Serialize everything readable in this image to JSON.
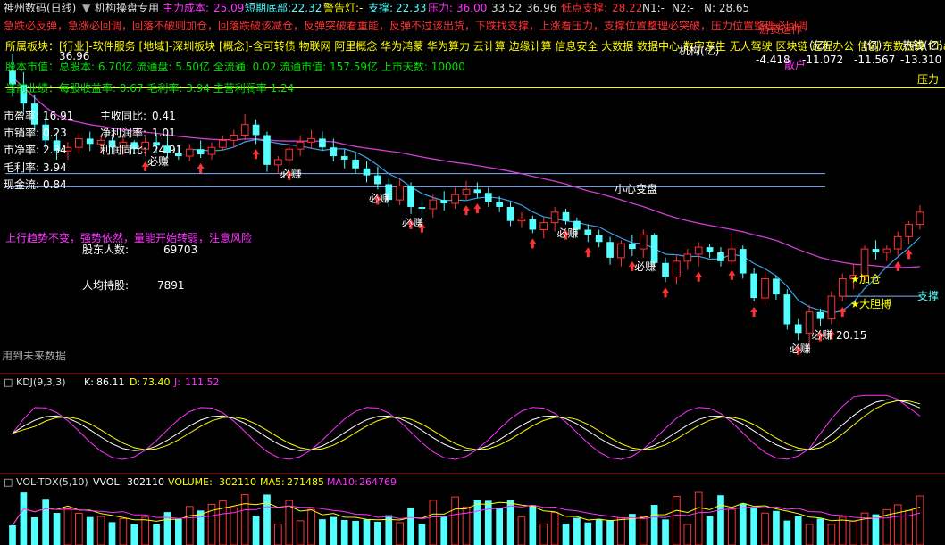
{
  "header": {
    "stock_name": "神州数码(日线)",
    "indicator_name": "机构操盘专用",
    "main_cost_label": "主力成本:",
    "main_cost": "25.09",
    "short_bottom_label": "短期底部:",
    "short_bottom": "22.32",
    "alarm_label": "警告灯:-",
    "support_label": "支撑:",
    "support": "22.33",
    "pressure_label": "压力:",
    "pressure": "36.00",
    "mid1": "33.52",
    "mid2": "36.96",
    "low_support_label": "低点支撑:",
    "low_support": "28.22",
    "n_values": "N1:-",
    "n2_value": "N2:-",
    "n_value": "N: 28.65"
  },
  "ticker_text": "急跌必反弹，急涨必回调，回落不破则加仓，回落跌破该减仓，反弹突破看重能，反弹不过该出货，下跌找支撑，上涨看压力，支撑位置整理必突破，压力位置整理必回调",
  "info": {
    "sector": "所属板块：[行业]-软件服务 [地域]-深圳板块 [概念]-含可转债 物联网 阿里概念 华为鸿蒙 华为算力 云计算 边缘计算 信息安全 大数据 数据中心 数字孪生 无人驾驶 区块链 远程办公 信创 东数西算 ChatGPT",
    "market_cap": "股本市值：总股本: 6.70亿 流通盘: 5.50亿 全流通: 0.02 流通市值: 157.59亿 上市天数: 10000",
    "performance": "当前业绩：每股收益率: 0.67 毛利率: 3.94 主营利润率 1.24",
    "pe_label": "市盈率:",
    "pe": "16.91",
    "ps_label": "市销率:",
    "ps": "0.23",
    "pb_label": "市净率:",
    "pb": "2.34",
    "gross_label": "毛利率:",
    "gross": "3.94",
    "cash_label": "现金流:",
    "cash": "0.84",
    "rev_yoy_label": "主收同比:",
    "rev_yoy": "0.41",
    "net_margin_label": "净利润率:",
    "net_margin": "1.01",
    "profit_yoy_label": "利润同比:",
    "profit_yoy": "24.91",
    "trend_text": "上行趋势不变，强势依然，量能开始转弱，注意风险",
    "holders_label": "股东人数:",
    "holders": "69703",
    "per_holding_label": "人均持股:",
    "per_holding": "7891",
    "future_data": "用到未来数据"
  },
  "price_chart": {
    "high_label": "36.96",
    "low_label": "20.15",
    "support_tag": "支撑",
    "pressure_tag": "压力",
    "caution_label": "小心变盘",
    "buy_label": "必赚",
    "add_label": "加仓",
    "bold_label": "大胆搏",
    "right_labels": {
      "top": "游资运作",
      "institution": "机构(亿)",
      "retail": "散户",
      "m1": "(亿)",
      "m2": "(亿)",
      "hot": "热钱(亿)",
      "v1": "-4.418",
      "v2": "-11.072",
      "v3": "-11.567",
      "v4": "-13.310"
    }
  },
  "kdj": {
    "title": "KDJ(9,3,3)",
    "k_label": "K:",
    "k": "86.11",
    "d_label": "D:",
    "d": "73.40",
    "j_label": "J:",
    "j": "111.52"
  },
  "vol": {
    "title": "VOL-TDX(5,10)",
    "vvol_label": "VVOL:",
    "vvol": "302110",
    "volume_label": "VOLUME:",
    "volume": "302110",
    "ma5_label": "MA5:",
    "ma5": "271485",
    "ma10_label": "MA10:",
    "ma10": "264769"
  },
  "colors": {
    "up": "#ff3232",
    "down": "#54ffff",
    "ma_purple": "#d33cd3",
    "ma_blue": "#3aa0e8",
    "yellow": "#ffff00",
    "magenta": "#ff32ff",
    "green": "#00e000"
  },
  "candles": [
    [
      36.0,
      36.96,
      34.5,
      35.2
    ],
    [
      35.2,
      35.9,
      33.6,
      34.1
    ],
    [
      34.1,
      34.6,
      32.5,
      32.9
    ],
    [
      32.9,
      33.4,
      31.5,
      32.0
    ],
    [
      32.0,
      32.4,
      30.9,
      31.4
    ],
    [
      31.4,
      31.9,
      30.9,
      31.6
    ],
    [
      31.6,
      32.4,
      31.2,
      32.1
    ],
    [
      32.1,
      32.5,
      31.4,
      31.8
    ],
    [
      31.8,
      32.3,
      31.3,
      32.0
    ],
    [
      32.0,
      32.2,
      31.3,
      31.6
    ],
    [
      31.6,
      32.3,
      31.2,
      31.9
    ],
    [
      31.9,
      32.0,
      31.2,
      31.5
    ],
    [
      31.5,
      32.2,
      31.1,
      31.9
    ],
    [
      31.9,
      32.4,
      31.3,
      31.7
    ],
    [
      31.7,
      32.3,
      31.0,
      31.3
    ],
    [
      31.3,
      31.7,
      30.9,
      31.1
    ],
    [
      31.1,
      31.8,
      30.8,
      31.5
    ],
    [
      31.5,
      32.0,
      31.0,
      31.2
    ],
    [
      31.2,
      31.9,
      30.9,
      31.6
    ],
    [
      31.6,
      32.3,
      31.4,
      32.0
    ],
    [
      32.0,
      32.6,
      31.6,
      32.3
    ],
    [
      32.3,
      33.5,
      32.0,
      32.9
    ],
    [
      32.9,
      33.2,
      31.8,
      32.3
    ],
    [
      32.3,
      32.5,
      30.2,
      30.6
    ],
    [
      30.6,
      31.1,
      30.1,
      30.9
    ],
    [
      30.9,
      31.8,
      30.6,
      31.5
    ],
    [
      31.5,
      32.3,
      31.1,
      31.9
    ],
    [
      31.9,
      32.6,
      31.5,
      32.1
    ],
    [
      32.1,
      32.5,
      31.4,
      31.6
    ],
    [
      31.6,
      32.1,
      30.8,
      31.1
    ],
    [
      31.1,
      31.5,
      30.4,
      30.9
    ],
    [
      30.9,
      31.3,
      30.1,
      30.4
    ],
    [
      30.4,
      30.8,
      29.6,
      30.0
    ],
    [
      30.0,
      30.5,
      29.2,
      29.5
    ],
    [
      29.5,
      29.9,
      28.2,
      28.6
    ],
    [
      28.6,
      29.8,
      28.3,
      29.4
    ],
    [
      29.4,
      29.6,
      27.8,
      28.2
    ],
    [
      28.2,
      28.7,
      27.6,
      28.1
    ],
    [
      28.1,
      28.9,
      27.6,
      28.6
    ],
    [
      28.6,
      29.1,
      28.0,
      28.4
    ],
    [
      28.4,
      29.3,
      28.1,
      28.9
    ],
    [
      28.9,
      29.7,
      28.6,
      29.2
    ],
    [
      29.2,
      29.6,
      28.7,
      29.0
    ],
    [
      29.0,
      29.3,
      28.2,
      28.5
    ],
    [
      28.5,
      28.8,
      27.9,
      28.2
    ],
    [
      28.2,
      28.5,
      27.1,
      27.4
    ],
    [
      27.4,
      27.9,
      27.0,
      27.5
    ],
    [
      27.5,
      27.7,
      26.7,
      26.9
    ],
    [
      26.9,
      27.6,
      26.4,
      27.3
    ],
    [
      27.3,
      28.2,
      26.8,
      27.9
    ],
    [
      27.9,
      28.1,
      27.2,
      27.4
    ],
    [
      27.4,
      27.6,
      26.6,
      26.9
    ],
    [
      26.9,
      27.2,
      26.2,
      26.6
    ],
    [
      26.6,
      26.9,
      25.9,
      26.2
    ],
    [
      26.2,
      26.5,
      24.9,
      25.3
    ],
    [
      25.3,
      26.3,
      24.8,
      26.1
    ],
    [
      26.1,
      26.6,
      25.4,
      25.8
    ],
    [
      25.8,
      26.9,
      25.3,
      26.6
    ],
    [
      26.6,
      26.7,
      24.8,
      25.0
    ],
    [
      25.0,
      25.3,
      23.9,
      24.2
    ],
    [
      24.2,
      25.4,
      23.8,
      25.1
    ],
    [
      25.1,
      25.8,
      24.6,
      25.5
    ],
    [
      25.5,
      26.2,
      24.8,
      25.9
    ],
    [
      25.9,
      26.1,
      25.3,
      25.6
    ],
    [
      25.6,
      25.9,
      24.8,
      25.1
    ],
    [
      25.1,
      26.7,
      24.9,
      25.8
    ],
    [
      25.8,
      26.0,
      24.1,
      24.4
    ],
    [
      24.4,
      24.7,
      22.8,
      23.0
    ],
    [
      23.0,
      24.5,
      22.6,
      24.1
    ],
    [
      24.1,
      24.3,
      22.9,
      23.2
    ],
    [
      23.2,
      23.5,
      21.2,
      21.5
    ],
    [
      21.5,
      21.8,
      20.6,
      21.0
    ],
    [
      21.0,
      22.6,
      20.15,
      22.2
    ],
    [
      22.2,
      22.4,
      21.4,
      21.8
    ],
    [
      21.8,
      23.4,
      21.5,
      23.1
    ],
    [
      23.1,
      24.4,
      22.8,
      24.1
    ],
    [
      24.1,
      24.9,
      23.5,
      24.3
    ],
    [
      24.3,
      26.0,
      24.0,
      25.8
    ],
    [
      25.8,
      26.3,
      25.2,
      25.6
    ],
    [
      25.6,
      26.0,
      25.1,
      25.8
    ],
    [
      25.8,
      26.8,
      25.4,
      26.5
    ],
    [
      26.5,
      27.4,
      26.1,
      27.2
    ],
    [
      27.2,
      28.3,
      26.9,
      27.9
    ]
  ]
}
